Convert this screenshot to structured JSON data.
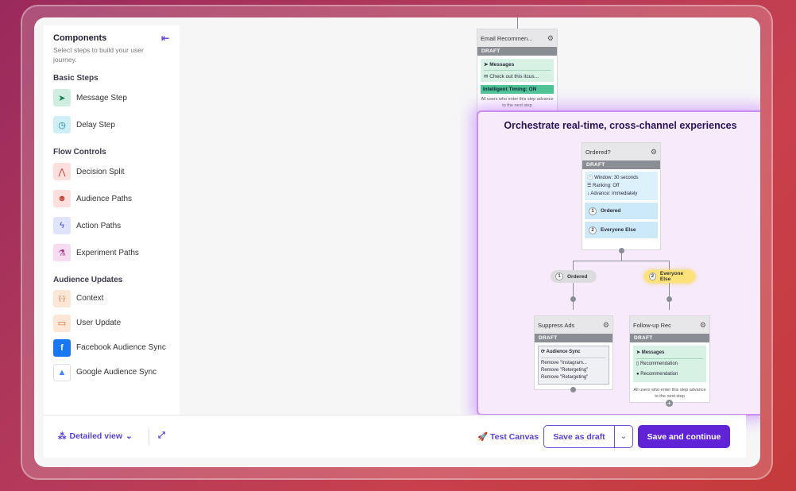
{
  "sidebar": {
    "title": "Components",
    "subtitle": "Select steps to build your user journey.",
    "sections": [
      {
        "title": "Basic Steps",
        "items": [
          {
            "label": "Message Step",
            "icon": "paper-plane-icon"
          },
          {
            "label": "Delay Step",
            "icon": "clock-icon"
          }
        ]
      },
      {
        "title": "Flow Controls",
        "items": [
          {
            "label": "Decision Split",
            "icon": "split-icon"
          },
          {
            "label": "Audience Paths",
            "icon": "people-icon"
          },
          {
            "label": "Action Paths",
            "icon": "bolt-icon"
          },
          {
            "label": "Experiment Paths",
            "icon": "flask-icon"
          }
        ]
      },
      {
        "title": "Audience Updates",
        "items": [
          {
            "label": "Context",
            "icon": "braces-icon"
          },
          {
            "label": "User Update",
            "icon": "id-card-icon"
          },
          {
            "label": "Facebook Audience Sync",
            "icon": "facebook-icon"
          },
          {
            "label": "Google Audience Sync",
            "icon": "google-ads-icon"
          }
        ]
      }
    ]
  },
  "canvas": {
    "highlight_title": "Orchestrate real-time, cross-channel experiences",
    "email_node": {
      "title": "Email Recommen...",
      "status": "DRAFT",
      "channel": "Messages",
      "message": "Check out this itcus...",
      "timing": "Intelligent Timing: ON",
      "footer": "All users who enter this step advance to the next step"
    },
    "ordered_node": {
      "title": "Ordered?",
      "status": "DRAFT",
      "window": "Window: 30 seconds",
      "ranking": "Ranking: Off",
      "advance": "Advance: Immediately",
      "paths": [
        {
          "num": "1",
          "label": "Ordered"
        },
        {
          "num": "2",
          "label": "Everyone Else"
        }
      ]
    },
    "pills": [
      {
        "num": "1",
        "label": "Ordered"
      },
      {
        "num": "2",
        "label": "Everyone Else"
      }
    ],
    "suppress_node": {
      "title": "Suppress Ads",
      "status": "DRAFT",
      "sync": "Audience Sync",
      "lines": [
        "Remove \"Instagram...",
        "Remove \"Retergeting\"",
        "Remove \"Retargeting\""
      ]
    },
    "followup_node": {
      "title": "Follow-up Rec",
      "status": "DRAFT",
      "channel": "Messages",
      "lines": [
        "Recommendation",
        "Recommendation"
      ],
      "footer": "All users who enter this step advance to the next step"
    }
  },
  "bottombar": {
    "view_label": "Detailed view",
    "test_label": "Test Canvas",
    "draft_label": "Save as draft",
    "save_label": "Save and continue"
  },
  "colors": {
    "accent": "#6024d6",
    "highlight": "#c88ff0",
    "draft": "#8b8d94"
  }
}
